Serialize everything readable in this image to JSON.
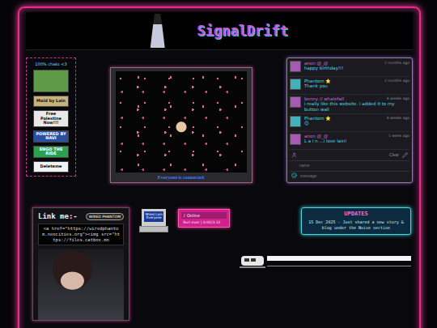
{
  "header": {
    "title": "SignalDrift"
  },
  "sidebar": {
    "title": "100% chaks <3",
    "badges": [
      {
        "label": "",
        "color": "#5e9a48"
      },
      {
        "label": "Maid by Lain",
        "color": "#c9b27a"
      },
      {
        "label": "Free Palestine Now!!!",
        "color": "#e8e8e8"
      },
      {
        "label": "POWERED BY NAVI",
        "color": "#2a4ea0"
      },
      {
        "label": "ENGO THE RIDE",
        "color": "#2e9e4f"
      },
      {
        "label": "Deleteme",
        "color": "#f2f2f2"
      }
    ]
  },
  "feature": {
    "caption": "Everyone is connected."
  },
  "chat": {
    "messages": [
      {
        "name": "anon @_@",
        "time": "2 months ago",
        "text": "happy birthday!!!",
        "color": "#c96bd6"
      },
      {
        "name": "Phantom ⭐",
        "time": "2 months ago",
        "text": "Thank you",
        "color": "#4fd6e0"
      },
      {
        "name": "benny // whalefall",
        "time": "4 weeks ago",
        "text": "i really like this website. i added it to my button wall",
        "color": "#c96bd6"
      },
      {
        "name": "Phantom ⭐",
        "time": "4 weeks ago",
        "text": "😊",
        "color": "#4fd6e0"
      },
      {
        "name": "anon @_@",
        "time": "1 week ago",
        "text": "L a i n ...i love lain!",
        "color": "#c96bd6"
      }
    ],
    "clear": "Clear",
    "name_placeholder": "name",
    "message_placeholder": "message"
  },
  "link": {
    "title": "Link me:-",
    "badge": "WIRED PHANTOM",
    "code": "<a href=\"https://wiredphantom.neocities.org\"><img src=\"https://files.catbox.mo"
  },
  "computer": {
    "screen": "Wired Lain Everyone"
  },
  "player": {
    "status": "♪ Online",
    "track": "Ruri ever | 0:00/3:31"
  },
  "updates": {
    "title": "UPDATES",
    "text": "15 Dec 2025 - Just shared a new story & blog under the Noise section"
  }
}
